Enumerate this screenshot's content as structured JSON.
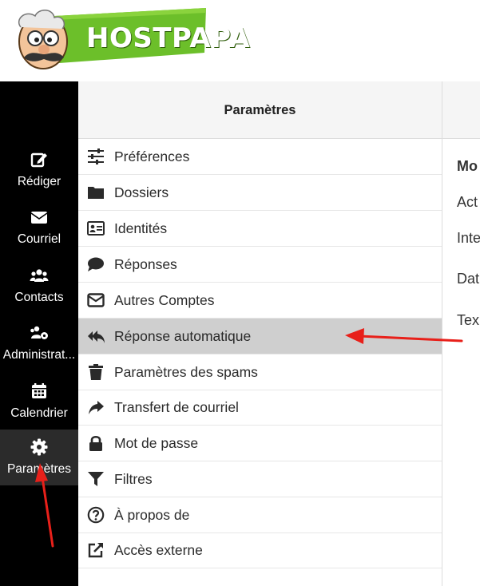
{
  "logo": {
    "text": "HOSTPAPA"
  },
  "nav": {
    "items": [
      {
        "label": "Rédiger",
        "icon": "compose-icon"
      },
      {
        "label": "Courriel",
        "icon": "envelope-icon"
      },
      {
        "label": "Contacts",
        "icon": "users-icon"
      },
      {
        "label": "Administrat...",
        "icon": "users-cog-icon"
      },
      {
        "label": "Calendrier",
        "icon": "calendar-icon"
      },
      {
        "label": "Paramètres",
        "icon": "gear-icon"
      }
    ],
    "active": "Paramètres"
  },
  "settings": {
    "title": "Paramètres",
    "items": [
      {
        "label": "Préférences",
        "icon": "sliders-icon"
      },
      {
        "label": "Dossiers",
        "icon": "folder-icon"
      },
      {
        "label": "Identités",
        "icon": "id-card-icon"
      },
      {
        "label": "Réponses",
        "icon": "comment-icon"
      },
      {
        "label": "Autres Comptes",
        "icon": "envelope-outline-icon"
      },
      {
        "label": "Réponse automatique",
        "icon": "reply-all-icon"
      },
      {
        "label": "Paramètres des spams",
        "icon": "trash-icon"
      },
      {
        "label": "Transfert de courriel",
        "icon": "share-icon"
      },
      {
        "label": "Mot de passe",
        "icon": "lock-icon"
      },
      {
        "label": "Filtres",
        "icon": "filter-icon"
      },
      {
        "label": "À propos de",
        "icon": "question-circle-icon"
      },
      {
        "label": "Accès externe",
        "icon": "external-link-icon"
      }
    ],
    "selected": "Réponse automatique"
  },
  "right_panel": {
    "texts": [
      "Mo",
      "Act",
      "Inte",
      "Dat",
      "Tex"
    ]
  },
  "colors": {
    "nav_bg": "#000000",
    "selected_row": "#cfcfcf",
    "arrow": "#e8201a",
    "logo_green": "#6cbf2a"
  }
}
